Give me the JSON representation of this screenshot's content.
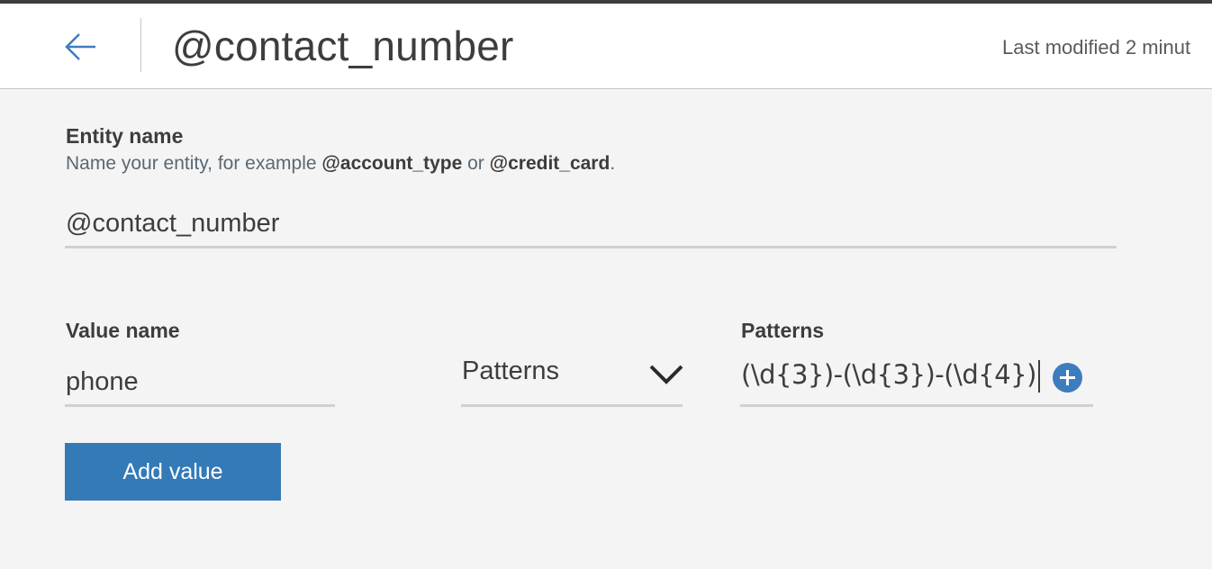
{
  "header": {
    "title": "@contact_number",
    "last_modified": "Last modified 2 minut",
    "back_icon": "arrow-left-icon"
  },
  "entity": {
    "label": "Entity name",
    "helper_prefix": "Name your entity, for example ",
    "helper_example1": "@account_type",
    "helper_middle": " or ",
    "helper_example2": "@credit_card",
    "helper_suffix": ".",
    "value": "@contact_number"
  },
  "value_row": {
    "value_label": "Value name",
    "value": "phone",
    "type_selected": "Patterns",
    "type_icon": "chevron-down-icon",
    "patterns_label": "Patterns",
    "pattern_value": "(\\d{3})-(\\d{3})-(\\d{4})",
    "add_pattern_icon": "plus-circle-icon"
  },
  "actions": {
    "add_value_label": "Add value"
  },
  "colors": {
    "accent": "#337ab7",
    "back_arrow": "#3e7cc0",
    "header_bg": "#ffffff",
    "page_bg": "#f4f4f4"
  }
}
